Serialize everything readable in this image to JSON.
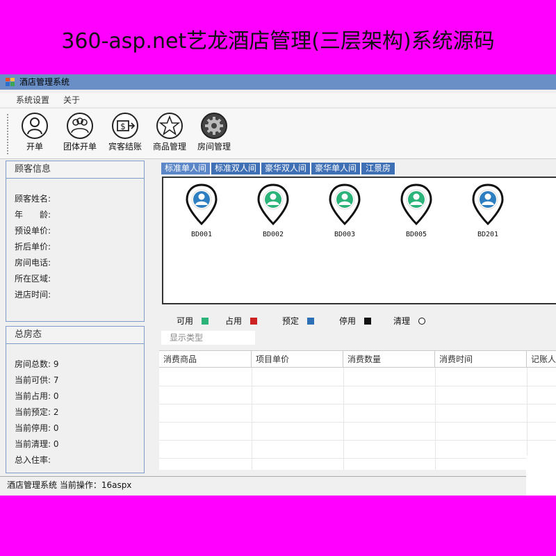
{
  "banner": {
    "text": "360-asp.net艺龙酒店管理(三层架构)系统源码"
  },
  "window": {
    "title": "酒店管理系统"
  },
  "menu": {
    "items": [
      "系统设置",
      "关于"
    ]
  },
  "toolbar": {
    "buttons": [
      {
        "label": "开单",
        "icon": "person-icon"
      },
      {
        "label": "团体开单",
        "icon": "group-icon"
      },
      {
        "label": "宾客结账",
        "icon": "checkout-icon"
      },
      {
        "label": "商品管理",
        "icon": "star-icon"
      },
      {
        "label": "房间管理",
        "icon": "gear-icon"
      }
    ]
  },
  "guest_panel": {
    "title": "顾客信息",
    "fields": [
      "顾客姓名:",
      "年　　龄:",
      "预设单价:",
      "折后单价:",
      "房间电话:",
      "所在区域:",
      "进店时间:"
    ]
  },
  "status_panel": {
    "title": "总房态",
    "rows": [
      "房间总数: 9",
      "当前可供: 7",
      "当前占用: 0",
      "当前预定: 2",
      "当前停用: 0",
      "当前清理: 0",
      "总入住率:"
    ]
  },
  "tabs": [
    "标准单人间",
    "标准双人间",
    "豪华双人间",
    "豪华单人间",
    "江景房"
  ],
  "rooms": [
    {
      "code": "BD001",
      "color": "#2d7fc2"
    },
    {
      "code": "BD002",
      "color": "#2cb37a"
    },
    {
      "code": "BD003",
      "color": "#2cb37a"
    },
    {
      "code": "BD005",
      "color": "#2cb37a"
    },
    {
      "code": "BD201",
      "color": "#2d7fc2"
    }
  ],
  "legend": [
    {
      "label": "可用",
      "color": "#2cb37a"
    },
    {
      "label": "占用",
      "color": "#cc2222"
    },
    {
      "label": "预定",
      "color": "#2d6fb5"
    },
    {
      "label": "停用",
      "color": "#111111"
    },
    {
      "label": "清理",
      "color": "circle"
    }
  ],
  "filter": {
    "placeholder": "显示类型"
  },
  "grid": {
    "columns": [
      "消费商品",
      "项目单价",
      "消费数量",
      "消费时间",
      "记账人"
    ]
  },
  "statusbar": {
    "text": "酒店管理系统  当前操作：16aspx"
  }
}
